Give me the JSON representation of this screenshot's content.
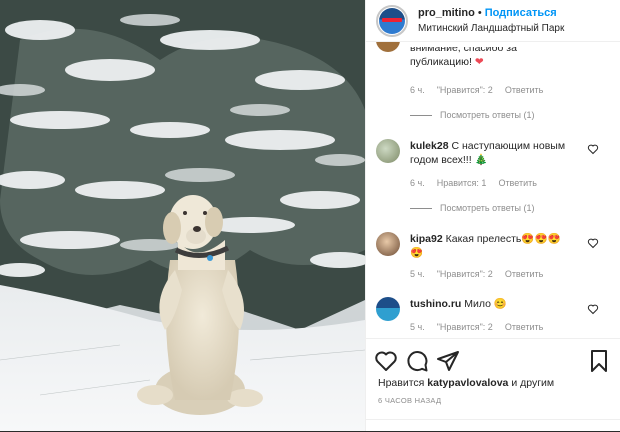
{
  "header": {
    "username": "pro_mitino",
    "separator": "•",
    "follow_label": "Подписаться",
    "location": "Митинский Ландшафтный Парк"
  },
  "comments": [
    {
      "text_partial": "внимание, спасибо за",
      "text_line2": "публикацию!",
      "emoji": "❤",
      "time": "6 ч.",
      "likes": "\"Нравится\": 2",
      "reply": "Ответить",
      "more": "Посмотреть ответы (1)"
    },
    {
      "user": "kulek28",
      "text_line1": "С наступающим новым",
      "text_line2": "годом всех!!!",
      "emoji": "🎄",
      "time": "6 ч.",
      "likes": "Нравится: 1",
      "reply": "Ответить",
      "more": "Посмотреть ответы (1)"
    },
    {
      "user": "kipa92",
      "text_line1": "Какая прелесть",
      "emoji_line1": "😍😍😍",
      "emoji_line2": "😍",
      "time": "5 ч.",
      "likes": "\"Нравится\": 2",
      "reply": "Ответить"
    },
    {
      "user": "tushino.ru",
      "text_line1": "Мило",
      "emoji": "😊",
      "time": "5 ч.",
      "likes": "\"Нравится\": 2",
      "reply": "Ответить"
    }
  ],
  "actions": {
    "likes_prefix": "Нравится",
    "likes_user": "katypavlovalova",
    "likes_suffix": "и другим",
    "posted_time": "6 ЧАСОВ НАЗАД"
  },
  "icons": {
    "like": "heart-icon",
    "comment": "comment-icon",
    "share": "share-icon",
    "save": "bookmark-icon"
  },
  "colors": {
    "follow": "#0095f6",
    "text": "#262626",
    "muted": "#8e8e8e",
    "heart_red": "#ed4956"
  }
}
